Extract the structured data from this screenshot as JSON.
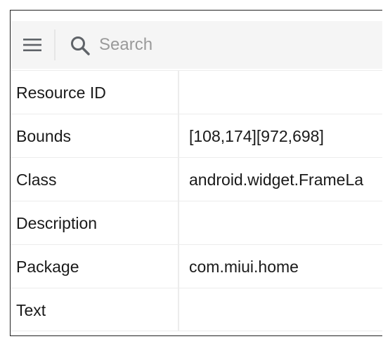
{
  "toolbar": {
    "menu_icon": "hamburger-menu-icon",
    "search_icon": "search-icon",
    "search_placeholder": "Search",
    "search_value": ""
  },
  "properties": [
    {
      "label": "Resource ID",
      "value": ""
    },
    {
      "label": "Bounds",
      "value": "[108,174][972,698]"
    },
    {
      "label": "Class",
      "value": "android.widget.FrameLa"
    },
    {
      "label": "Description",
      "value": ""
    },
    {
      "label": "Package",
      "value": "com.miui.home"
    },
    {
      "label": "Text",
      "value": ""
    }
  ],
  "colors": {
    "toolbar_bg": "#f5f5f5",
    "icon": "#5f6368",
    "placeholder": "#9a9a9a",
    "text": "#1a1a1a",
    "grid_line": "#ececec"
  }
}
